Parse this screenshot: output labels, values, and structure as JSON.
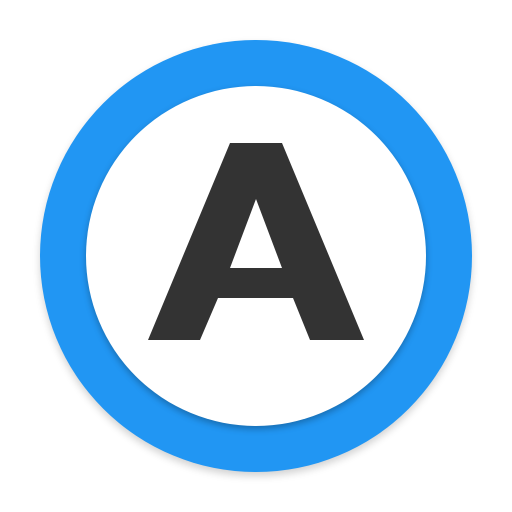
{
  "app_icon": {
    "letter": "A",
    "icon_name": "letter-a-circle-icon",
    "colors": {
      "ring": "#2196F3",
      "inner": "#FFFFFF",
      "letter": "#333333"
    }
  }
}
